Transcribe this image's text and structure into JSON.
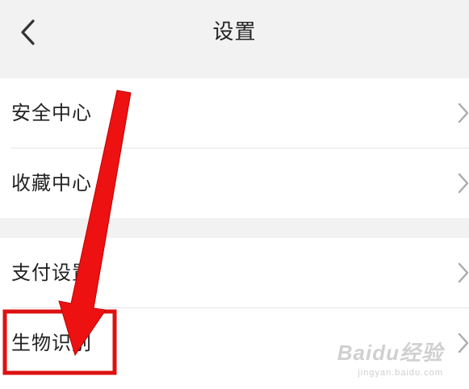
{
  "header": {
    "title": "设置",
    "back_icon": "chevron-left-icon"
  },
  "groups": [
    {
      "items": [
        {
          "label": "安全中心",
          "icon": "chevron-right-icon"
        },
        {
          "label": "收藏中心",
          "icon": "chevron-right-icon"
        }
      ]
    },
    {
      "items": [
        {
          "label": "支付设置",
          "icon": "chevron-right-icon"
        },
        {
          "label": "生物识别",
          "icon": "chevron-right-icon"
        }
      ]
    }
  ],
  "annotation": {
    "arrow_color": "#ee1111",
    "highlight_color": "#dd1111",
    "highlighted_item": "生物识别"
  },
  "watermark": {
    "brand": "Baidu经验",
    "url": "jingyan.baidu.com"
  },
  "colors": {
    "page_background": "#f2f2f2",
    "row_background": "#ffffff",
    "divider": "#e3e3e3",
    "text": "#222222",
    "chevron": "#aaaaaa"
  }
}
